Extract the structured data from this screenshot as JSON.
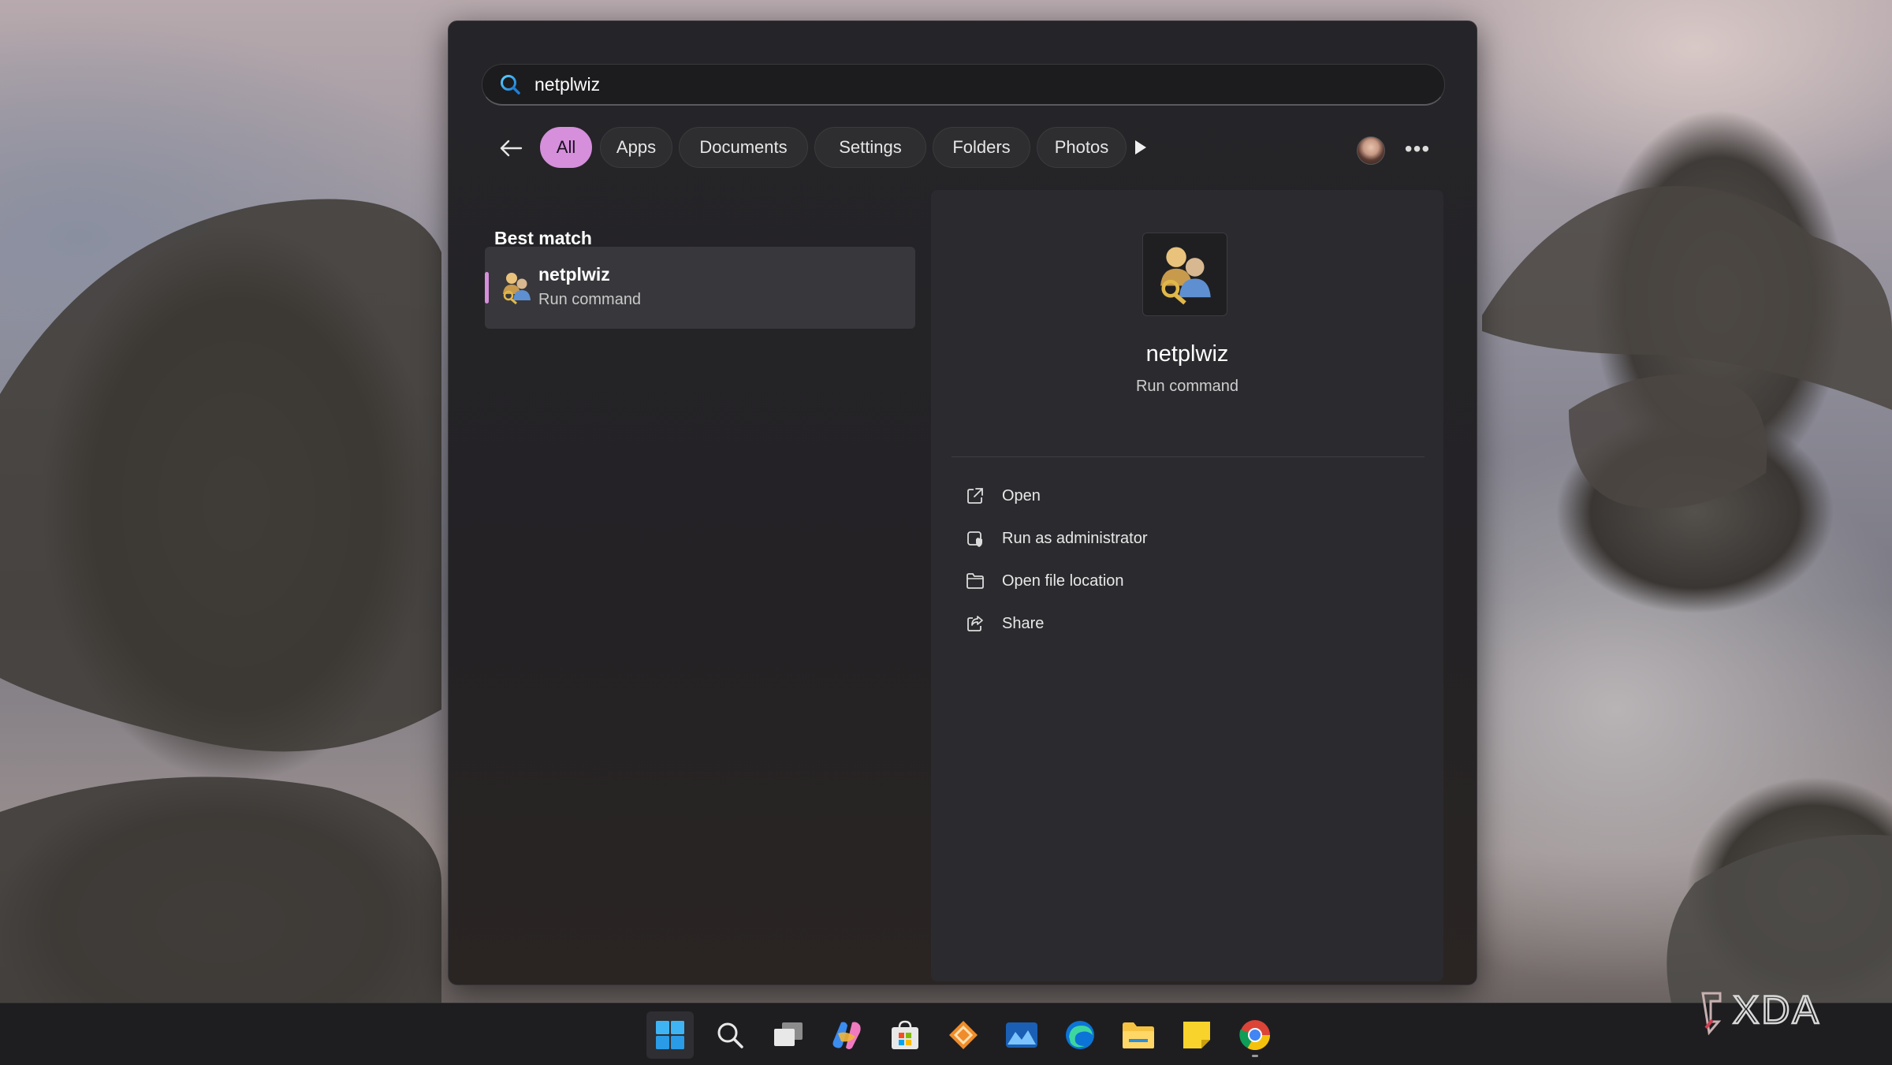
{
  "search": {
    "query": "netplwiz"
  },
  "filters": {
    "items": [
      "All",
      "Apps",
      "Documents",
      "Settings",
      "Folders",
      "Photos"
    ],
    "selected": "All"
  },
  "best_match": {
    "title": "Best match",
    "result": {
      "name": "netplwiz",
      "type": "Run command"
    }
  },
  "detail": {
    "name": "netplwiz",
    "type": "Run command",
    "actions": [
      "Open",
      "Run as administrator",
      "Open file location",
      "Share"
    ]
  },
  "taskbar": {
    "apps": [
      "start-icon",
      "search-icon",
      "task-view-icon",
      "copilot-icon",
      "microsoft-store-icon",
      "app-diamond-icon",
      "photos-icon",
      "edge-icon",
      "file-explorer-icon",
      "sticky-notes-icon",
      "chrome-icon"
    ]
  },
  "colors": {
    "accent": "#d58fdb",
    "panel": "#242225",
    "taskbar": "#1e1e21"
  },
  "watermark": "XDA"
}
